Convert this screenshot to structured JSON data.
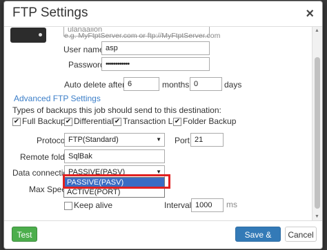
{
  "dialog": {
    "title": "FTP Settings",
    "close_glyph": "×"
  },
  "form": {
    "server_value": "ulanaaiion",
    "server_hint": "e.g. MyFtptServer.com or ftp://MyFtptServer.com",
    "username_label": "User name:",
    "username_value": "asp",
    "password_label": "Password:",
    "password_value": "••••••••••••",
    "auto_delete_label": "Auto delete after",
    "months_value": "6",
    "months_label": "months",
    "days_value": "0",
    "days_label": "days",
    "advanced_link": "Advanced FTP Settings",
    "backup_types_label": "Types of backups this job should send to this destination:",
    "checkboxes": [
      {
        "label": "Full Backup",
        "checked": true
      },
      {
        "label": "Differential",
        "checked": true
      },
      {
        "label": "Transaction Log",
        "checked": true
      },
      {
        "label": "Folder Backup",
        "checked": true
      }
    ],
    "protocol_label": "Protocol:",
    "protocol_value": "FTP(Standard)",
    "port_label": "Port:",
    "port_value": "21",
    "remote_folder_label": "Remote folder:",
    "remote_folder_value": "SqlBak",
    "data_connection_label": "Data connection:",
    "data_connection_value": "PASSIVE(PASV)",
    "data_connection_options": [
      "PASSIVE(PASV)",
      "ACTIVE(PORT)"
    ],
    "max_speed_label": "Max Speed:",
    "keep_alive_label": "Keep alive",
    "keep_alive_checked": false,
    "interval_label": "Interval:",
    "interval_value": "1000",
    "interval_unit": "ms"
  },
  "buttons": {
    "test": "Test",
    "save_close": "Save & Close",
    "cancel": "Cancel"
  },
  "icons": {
    "server": "server-icon",
    "close": "close-icon",
    "check": "✔",
    "caret": "▼"
  },
  "colors": {
    "test_button": "#4cae4c",
    "save_button": "#337ab7",
    "link": "#3b7ec8",
    "highlight": "#e02020",
    "selected_option": "#3a6cc4"
  }
}
